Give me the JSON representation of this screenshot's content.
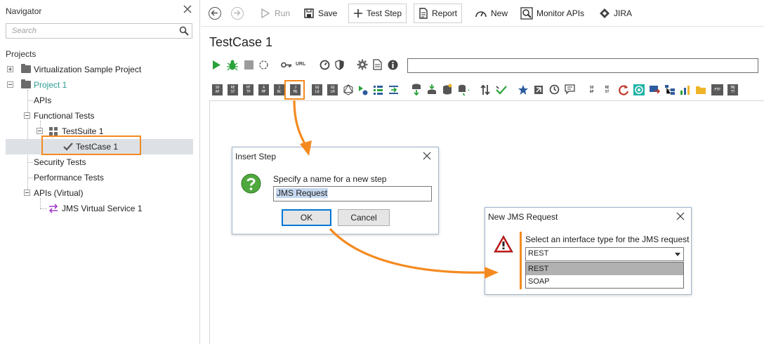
{
  "navigator": {
    "title": "Navigator",
    "search_placeholder": "Search",
    "projects_label": "Projects",
    "tree": {
      "virtualization_project": "Virtualization Sample Project",
      "project1": "Project 1",
      "apis": "APIs",
      "functional_tests": "Functional Tests",
      "testsuite": "TestSuite 1",
      "testcase": "TestCase 1",
      "security_tests": "Security Tests",
      "performance_tests": "Performance Tests",
      "apis_virtual": "APIs (Virtual)",
      "jms_virtual_service": "JMS Virtual Service 1"
    },
    "project_color": "#2a9d8f"
  },
  "toolbar": {
    "run": "Run",
    "save": "Save",
    "test_step": "Test Step",
    "report": "Report",
    "new": "New",
    "monitor_apis": "Monitor APIs",
    "jira": "JIRA"
  },
  "testcase": {
    "title": "TestCase 1",
    "url_icon_label": "URL"
  },
  "step_icons": [
    {
      "top": "SO",
      "bottom": "AP"
    },
    {
      "top": "RE",
      "bottom": "ST"
    },
    {
      "top": "HT",
      "bottom": "TP"
    },
    {
      "top": "A",
      "bottom": "MF"
    },
    {
      "top": "J",
      "bottom": "BC"
    },
    {
      "top": "J",
      "bottom": "MS"
    },
    {
      "top": "GQ",
      "bottom": "LQ"
    },
    {
      "top": "GQ",
      "bottom": "LM"
    }
  ],
  "right_step_icons": [
    {
      "top": "SO",
      "bottom": "AP"
    },
    {
      "top": "RE",
      "bottom": "ST"
    },
    {
      "top": "FTP",
      "bottom": ""
    },
    {
      "top": "MQ",
      "bottom": "TT"
    }
  ],
  "insert_step_dialog": {
    "title": "Insert Step",
    "prompt": "Specify a name for a new step",
    "value": "JMS Request",
    "ok": "OK",
    "cancel": "Cancel"
  },
  "jms_dialog": {
    "title": "New JMS Request",
    "prompt": "Select an interface type for the JMS request",
    "selected": "REST",
    "options": [
      "REST",
      "SOAP"
    ]
  },
  "colors": {
    "accent_orange": "#f48a1f",
    "run_green": "#2aa23a",
    "selection": "#dde0e4"
  }
}
